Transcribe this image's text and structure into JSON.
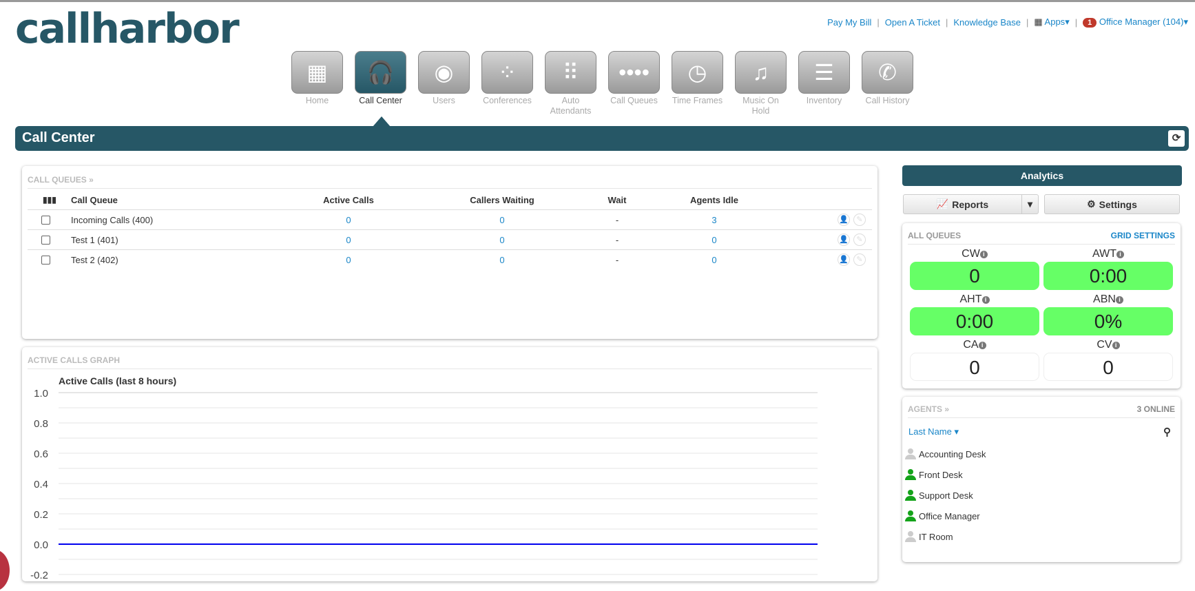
{
  "brand": {
    "logo_text": "callharbor"
  },
  "toplinks": {
    "pay": "Pay My Bill",
    "ticket": "Open A Ticket",
    "kb": "Knowledge Base",
    "apps": "Apps",
    "badge": "1",
    "user": "Office Manager (104)"
  },
  "nav": [
    {
      "label": "Home",
      "icon": "building-icon",
      "glyph": "▦"
    },
    {
      "label": "Call Center",
      "icon": "headset-icon",
      "glyph": "🎧"
    },
    {
      "label": "Users",
      "icon": "users-icon",
      "glyph": "◉"
    },
    {
      "label": "Conferences",
      "icon": "conference-icon",
      "glyph": "⁘"
    },
    {
      "label": "Auto Attendants",
      "icon": "keypad-icon",
      "glyph": "⠿"
    },
    {
      "label": "Call Queues",
      "icon": "queue-dots-icon",
      "glyph": "••••"
    },
    {
      "label": "Time Frames",
      "icon": "clock-icon",
      "glyph": "◷"
    },
    {
      "label": "Music On Hold",
      "icon": "music-note-icon",
      "glyph": "♫"
    },
    {
      "label": "Inventory",
      "icon": "list-icon",
      "glyph": "☰"
    },
    {
      "label": "Call History",
      "icon": "phone-history-icon",
      "glyph": "✆"
    }
  ],
  "page_title": "Call Center",
  "call_queues": {
    "title": "CALL QUEUES »",
    "headers": {
      "name": "Call Queue",
      "active": "Active Calls",
      "waiting": "Callers Waiting",
      "wait": "Wait",
      "idle": "Agents Idle"
    },
    "rows": [
      {
        "name": "Incoming Calls (400)",
        "active": "0",
        "waiting": "0",
        "wait": "-",
        "idle": "3"
      },
      {
        "name": "Test 1 (401)",
        "active": "0",
        "waiting": "0",
        "wait": "-",
        "idle": "0"
      },
      {
        "name": "Test 2 (402)",
        "active": "0",
        "waiting": "0",
        "wait": "-",
        "idle": "0"
      }
    ]
  },
  "graph": {
    "title": "ACTIVE CALLS GRAPH"
  },
  "chart_data": {
    "type": "line",
    "title": "Active Calls (last 8 hours)",
    "yticks": [
      "1.0",
      "0.8",
      "0.6",
      "0.4",
      "0.2",
      "0.0"
    ],
    "ylim": [
      -0.2,
      1.0
    ],
    "series": [
      {
        "name": "Active Calls",
        "values": [
          0,
          0
        ],
        "color": "#0000ee"
      }
    ]
  },
  "analytics": {
    "title": "Analytics",
    "reports": "Reports",
    "settings": "Settings"
  },
  "all_queues": {
    "title": "ALL QUEUES",
    "grid_settings": "GRID SETTINGS",
    "metrics": [
      {
        "label": "CW",
        "value": "0",
        "style": "green"
      },
      {
        "label": "AWT",
        "value": "0:00",
        "style": "green"
      },
      {
        "label": "AHT",
        "value": "0:00",
        "style": "green"
      },
      {
        "label": "ABN",
        "value": "0%",
        "style": "green"
      },
      {
        "label": "CA",
        "value": "0",
        "style": "white"
      },
      {
        "label": "CV",
        "value": "0",
        "style": "white"
      }
    ]
  },
  "agents": {
    "title": "AGENTS »",
    "online": "3 ONLINE",
    "sort": "Last Name",
    "list": [
      {
        "name": "Accounting Desk",
        "online": false
      },
      {
        "name": "Front Desk",
        "online": true
      },
      {
        "name": "Support Desk",
        "online": true
      },
      {
        "name": "Office Manager",
        "online": true
      },
      {
        "name": "IT Room",
        "online": false
      }
    ]
  }
}
